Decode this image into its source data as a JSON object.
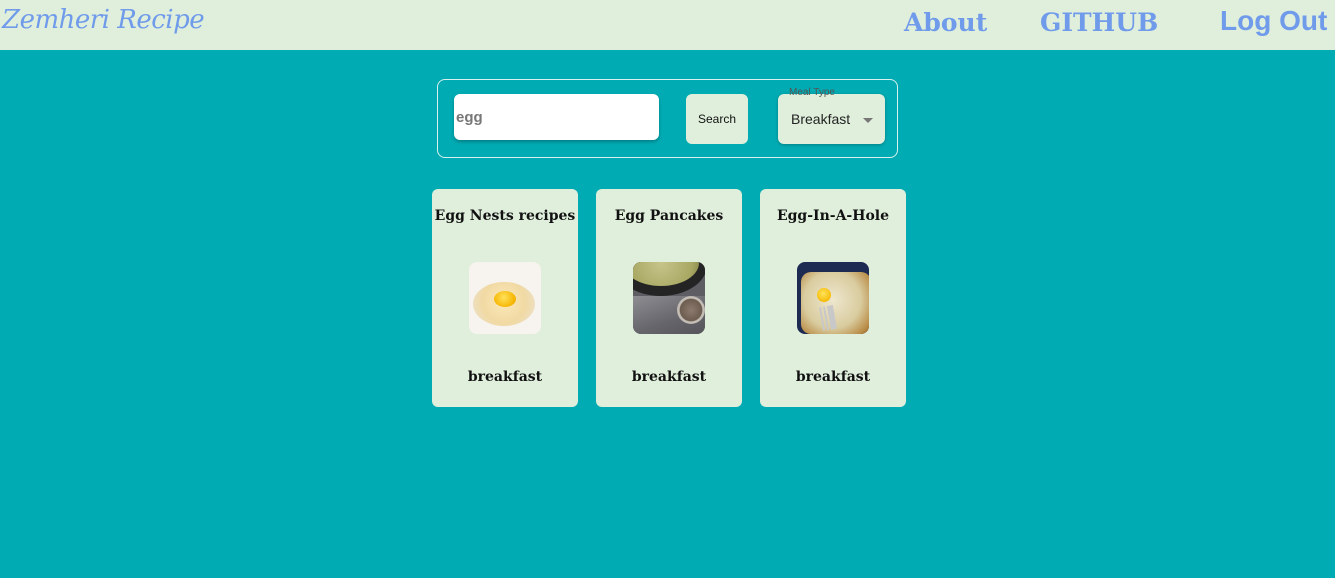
{
  "navbar": {
    "brand": "Zemheri Recipe",
    "links": {
      "about": "About",
      "github": "GITHUB",
      "logout": "Log Out"
    }
  },
  "search": {
    "value": "egg",
    "button_label": "Search",
    "meal_type": {
      "label": "Meal Type",
      "selected": "Breakfast"
    }
  },
  "recipes": [
    {
      "title": "Egg Nests recipes",
      "meal_type": "breakfast",
      "image_icon": "egg-nest-photo"
    },
    {
      "title": "Egg Pancakes",
      "meal_type": "breakfast",
      "image_icon": "egg-pancake-photo"
    },
    {
      "title": "Egg-In-A-Hole",
      "meal_type": "breakfast",
      "image_icon": "egg-in-a-hole-photo"
    }
  ],
  "colors": {
    "background": "#00abb3",
    "surface": "#e0efdc",
    "accent": "#6f9bea"
  }
}
